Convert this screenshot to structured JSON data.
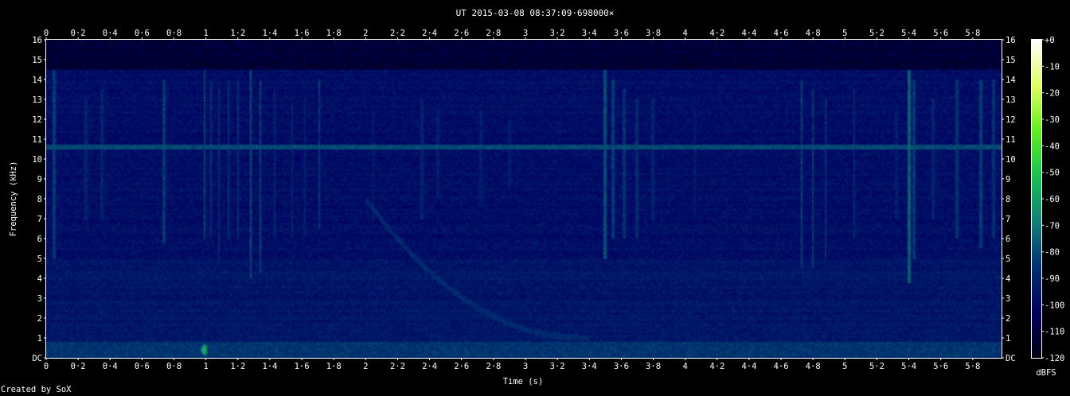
{
  "chart_data": {
    "type": "heatmap",
    "title": "UT 2015-03-08 08:37:09·698000×",
    "xlabel": "Time (s)",
    "ylabel": "Frequency (kHz)",
    "xlim": [
      0,
      5.98
    ],
    "ylim": [
      0,
      16
    ],
    "x_tick_labels": [
      "0",
      "0·2",
      "0·4",
      "0·6",
      "0·8",
      "1",
      "1·2",
      "1·4",
      "1·6",
      "1·8",
      "2",
      "2·2",
      "2·4",
      "2·6",
      "2·8",
      "3",
      "3·2",
      "3·4",
      "3·6",
      "3·8",
      "4",
      "4·2",
      "4·4",
      "4·6",
      "4·8",
      "5",
      "5·2",
      "5·4",
      "5·6",
      "5·8"
    ],
    "x_tick_values": [
      0,
      0.2,
      0.4,
      0.6,
      0.8,
      1,
      1.2,
      1.4,
      1.6,
      1.8,
      2,
      2.2,
      2.4,
      2.6,
      2.8,
      3,
      3.2,
      3.4,
      3.6,
      3.8,
      4,
      4.2,
      4.4,
      4.6,
      4.8,
      5,
      5.2,
      5.4,
      5.6,
      5.8
    ],
    "y_tick_labels": [
      "DC",
      "1",
      "2",
      "3",
      "4",
      "5",
      "6",
      "7",
      "8",
      "9",
      "10",
      "11",
      "12",
      "13",
      "14",
      "15",
      "16"
    ],
    "y_tick_values": [
      0,
      1,
      2,
      3,
      4,
      5,
      6,
      7,
      8,
      9,
      10,
      11,
      12,
      13,
      14,
      15,
      16
    ],
    "colorbar": {
      "label": "dBFS",
      "tick_labels": [
        "+0",
        "-10",
        "-20",
        "-30",
        "-40",
        "-50",
        "-60",
        "-70",
        "-80",
        "-90",
        "-100",
        "-110",
        "-120"
      ],
      "tick_values": [
        0,
        -10,
        -20,
        -30,
        -40,
        -50,
        -60,
        -70,
        -80,
        -90,
        -100,
        -110,
        -120
      ],
      "range": [
        -120,
        0
      ],
      "colors": [
        "#000010",
        "#000060",
        "#003070",
        "#10807a",
        "#18c050",
        "#60f020",
        "#e0ff60",
        "#ffffff"
      ]
    },
    "features": {
      "background_dbfs": -98,
      "persistent_tone_khz": 10.6,
      "persistent_tone_dbfs": -80,
      "low_freq_band_khz": [
        0,
        0.8
      ],
      "low_freq_band_dbfs": -85,
      "peak_event": {
        "time_s": 0.99,
        "freq_khz": 0.4,
        "dbfs": -55
      },
      "descending_sweep": {
        "start": [
          2.0,
          8.0
        ],
        "end": [
          3.4,
          1.0
        ]
      },
      "impulses": [
        {
          "t": 0.05,
          "top": 14.5,
          "bottom": 5.0,
          "dbfs": -84
        },
        {
          "t": 0.25,
          "top": 13.0,
          "bottom": 7.0,
          "dbfs": -90
        },
        {
          "t": 0.35,
          "top": 13.5,
          "bottom": 7.0,
          "dbfs": -90
        },
        {
          "t": 0.74,
          "top": 14.0,
          "bottom": 5.8,
          "dbfs": -84
        },
        {
          "t": 0.99,
          "top": 14.5,
          "bottom": 6.0,
          "dbfs": -82
        },
        {
          "t": 1.03,
          "top": 14.0,
          "bottom": 6.0,
          "dbfs": -86
        },
        {
          "t": 1.08,
          "top": 13.5,
          "bottom": 5.0,
          "dbfs": -88
        },
        {
          "t": 1.14,
          "top": 14.0,
          "bottom": 6.0,
          "dbfs": -86
        },
        {
          "t": 1.2,
          "top": 14.0,
          "bottom": 6.0,
          "dbfs": -86
        },
        {
          "t": 1.28,
          "top": 14.5,
          "bottom": 4.0,
          "dbfs": -80
        },
        {
          "t": 1.34,
          "top": 14.0,
          "bottom": 4.2,
          "dbfs": -82
        },
        {
          "t": 1.43,
          "top": 13.5,
          "bottom": 6.0,
          "dbfs": -88
        },
        {
          "t": 1.54,
          "top": 13.0,
          "bottom": 6.0,
          "dbfs": -90
        },
        {
          "t": 1.62,
          "top": 13.0,
          "bottom": 6.0,
          "dbfs": -90
        },
        {
          "t": 1.71,
          "top": 14.0,
          "bottom": 6.5,
          "dbfs": -84
        },
        {
          "t": 2.05,
          "top": 12.5,
          "bottom": 7.0,
          "dbfs": -92
        },
        {
          "t": 2.35,
          "top": 13.0,
          "bottom": 7.0,
          "dbfs": -90
        },
        {
          "t": 2.45,
          "top": 12.5,
          "bottom": 8.0,
          "dbfs": -92
        },
        {
          "t": 2.72,
          "top": 12.5,
          "bottom": 8.0,
          "dbfs": -92
        },
        {
          "t": 2.9,
          "top": 12.0,
          "bottom": 8.5,
          "dbfs": -93
        },
        {
          "t": 3.5,
          "top": 14.5,
          "bottom": 5.0,
          "dbfs": -80
        },
        {
          "t": 3.55,
          "top": 14.0,
          "bottom": 6.0,
          "dbfs": -84
        },
        {
          "t": 3.62,
          "top": 13.5,
          "bottom": 6.0,
          "dbfs": -86
        },
        {
          "t": 3.7,
          "top": 13.0,
          "bottom": 6.0,
          "dbfs": -88
        },
        {
          "t": 3.8,
          "top": 13.0,
          "bottom": 7.0,
          "dbfs": -90
        },
        {
          "t": 4.06,
          "top": 12.5,
          "bottom": 7.0,
          "dbfs": -92
        },
        {
          "t": 4.73,
          "top": 14.0,
          "bottom": 4.5,
          "dbfs": -82
        },
        {
          "t": 4.8,
          "top": 13.5,
          "bottom": 4.5,
          "dbfs": -84
        },
        {
          "t": 4.88,
          "top": 13.0,
          "bottom": 5.0,
          "dbfs": -86
        },
        {
          "t": 5.06,
          "top": 13.5,
          "bottom": 6.0,
          "dbfs": -88
        },
        {
          "t": 5.32,
          "top": 12.5,
          "bottom": 7.0,
          "dbfs": -92
        },
        {
          "t": 5.4,
          "top": 14.5,
          "bottom": 3.8,
          "dbfs": -76
        },
        {
          "t": 5.43,
          "top": 14.0,
          "bottom": 5.0,
          "dbfs": -84
        },
        {
          "t": 5.55,
          "top": 13.0,
          "bottom": 7.0,
          "dbfs": -90
        },
        {
          "t": 5.7,
          "top": 14.0,
          "bottom": 6.0,
          "dbfs": -86
        },
        {
          "t": 5.85,
          "top": 14.0,
          "bottom": 5.5,
          "dbfs": -84
        },
        {
          "t": 5.93,
          "top": 14.0,
          "bottom": 6.0,
          "dbfs": -86
        }
      ]
    }
  },
  "footer": {
    "credit": "Created by SoX"
  }
}
